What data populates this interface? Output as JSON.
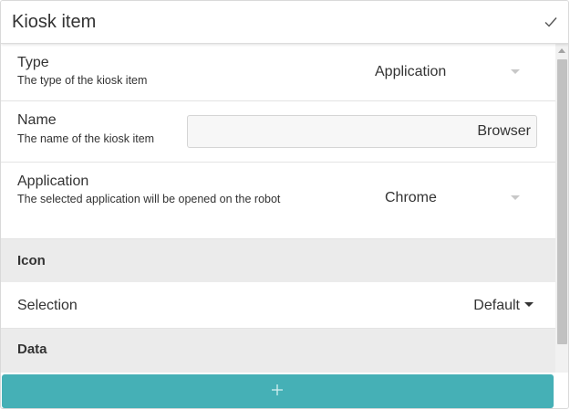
{
  "header": {
    "title": "Kiosk item",
    "confirm_icon": "check-icon"
  },
  "fields": {
    "type": {
      "title": "Type",
      "description": "The type of the kiosk item",
      "value": "Application"
    },
    "name": {
      "title": "Name",
      "description": "The name of the kiosk item",
      "value": "Browser"
    },
    "application": {
      "title": "Application",
      "description": "The selected application will be opened on the robot",
      "value": "Chrome"
    }
  },
  "icon_section": {
    "label": "Icon",
    "selection_label": "Selection",
    "selection_value": "Default"
  },
  "data_section": {
    "label": "Data"
  },
  "add_button": {
    "icon": "plus-icon"
  },
  "colors": {
    "accent": "#45b0b6",
    "section_background": "#ebebeb"
  }
}
